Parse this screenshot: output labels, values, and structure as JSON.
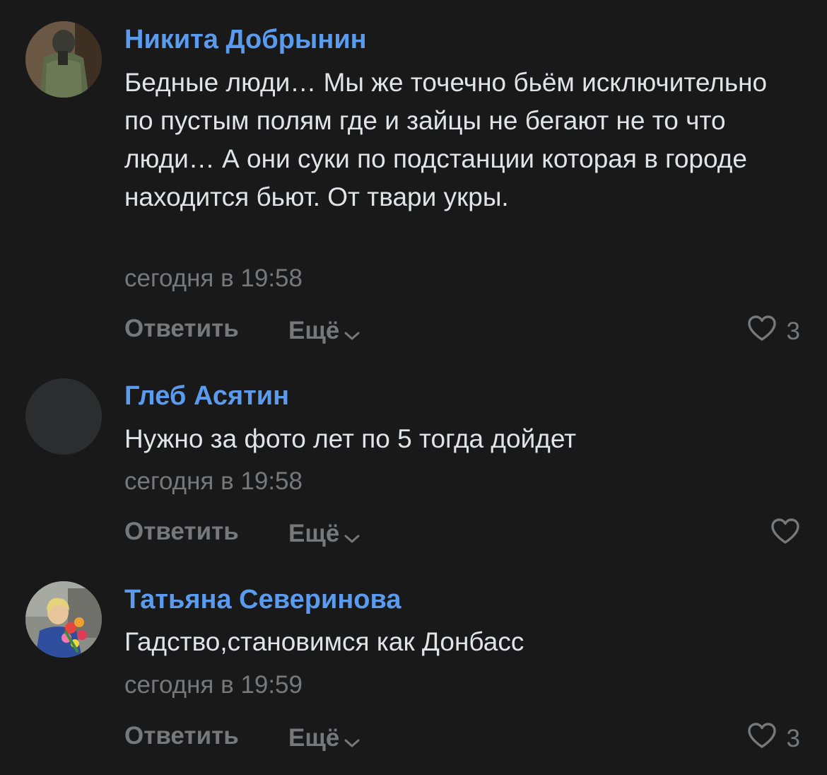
{
  "comments": [
    {
      "author": "Никита Добрынин",
      "text": "Бедные люди… Мы же точечно бьём исключительно по пустым полям где и зайцы не бегают не то что люди… А они суки по подстанции которая в городе находится бьют. От твари укры.",
      "date": "сегодня в 19:58",
      "reply_label": "Ответить",
      "more_label": "Ещё",
      "likes": "3"
    },
    {
      "author": "Глеб Асятин",
      "text": "Нужно за фото лет по 5 тогда дойдет",
      "date": "сегодня в 19:58",
      "reply_label": "Ответить",
      "more_label": "Ещё",
      "likes": ""
    },
    {
      "author": "Татьяна Северинова",
      "text": "Гадство,становимся как Донбасс",
      "date": "сегодня в 19:59",
      "reply_label": "Ответить",
      "more_label": "Ещё",
      "likes": "3"
    }
  ],
  "colors": {
    "background": "#19191a",
    "author": "#5a9bed",
    "text": "#e1e3e6",
    "secondary": "#76787a"
  },
  "icons": {
    "like": "heart-outline-icon",
    "more": "chevron-down-icon"
  }
}
